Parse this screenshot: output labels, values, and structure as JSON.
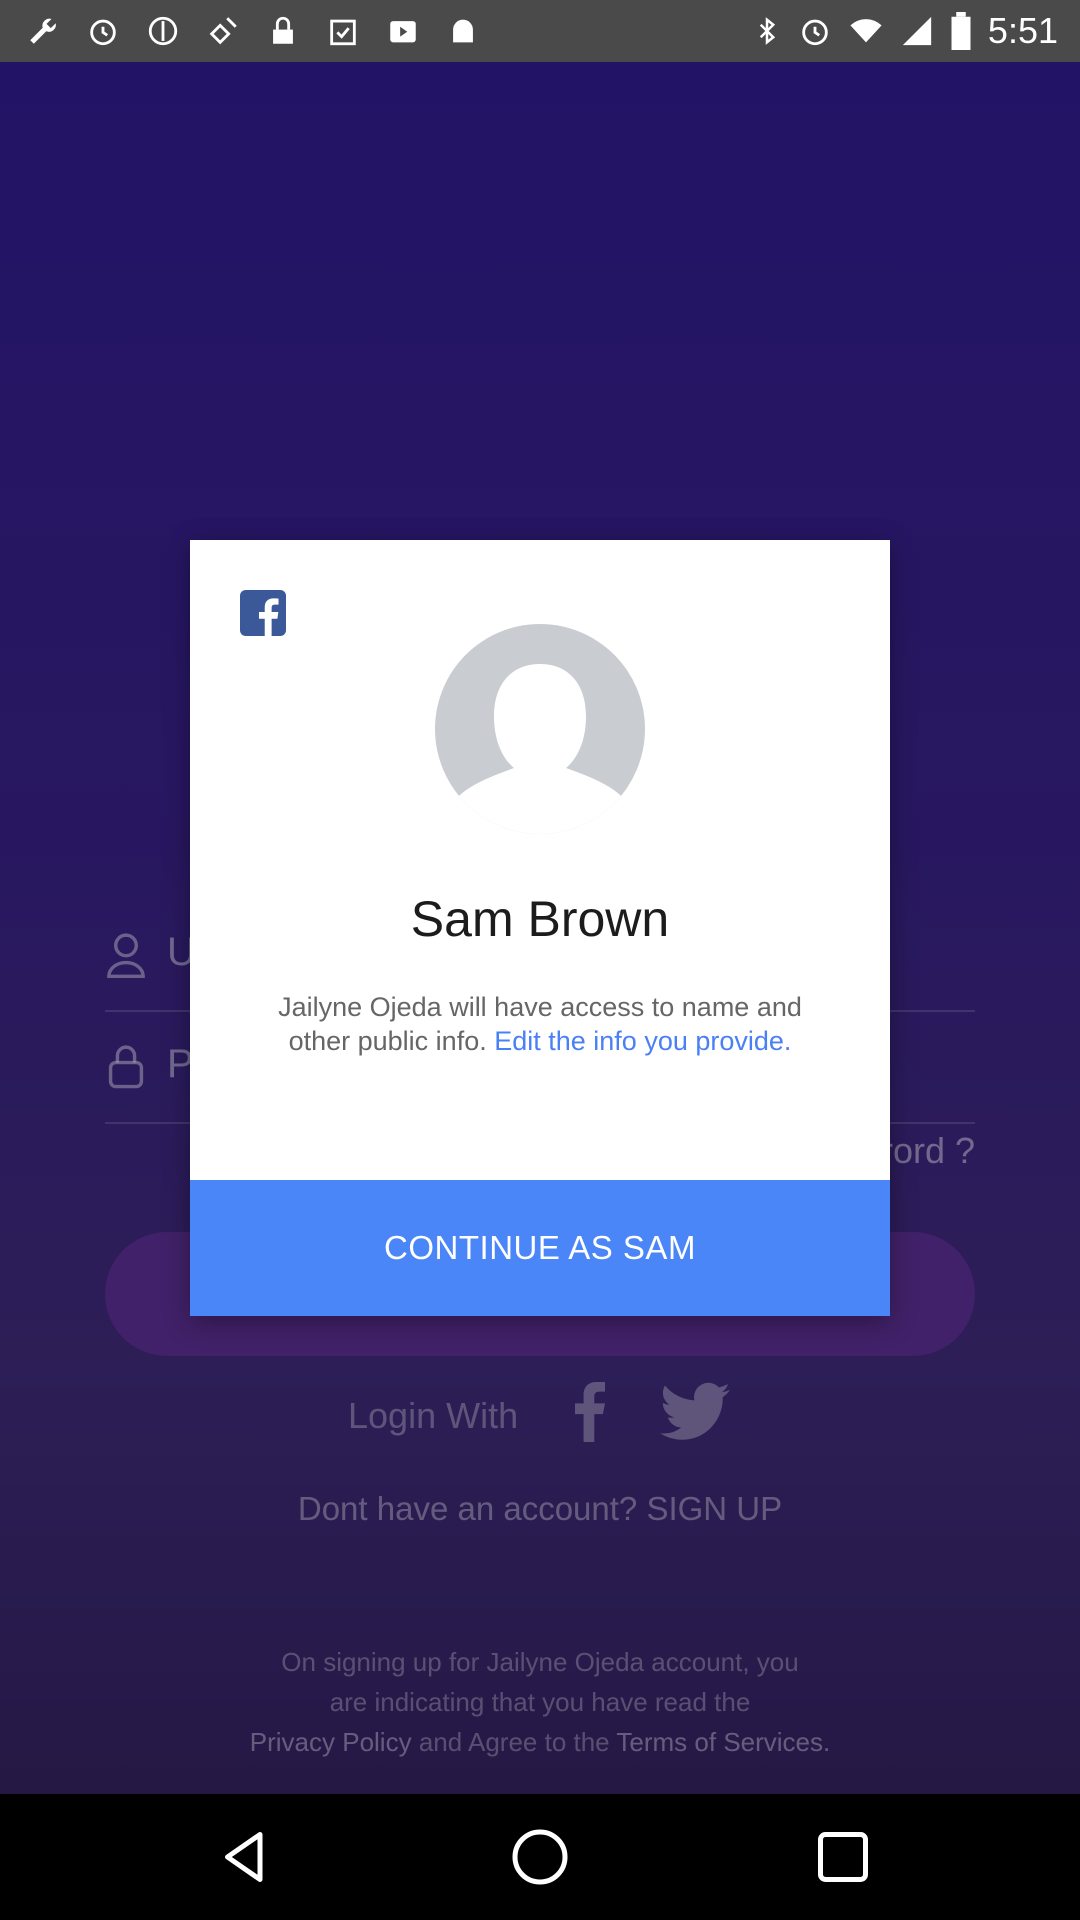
{
  "status_bar": {
    "time": "5:51",
    "left_icons": [
      "wrench-icon",
      "alarm-icon",
      "circle-icon",
      "satellite-icon",
      "lock-icon",
      "clipboard-check-icon",
      "play-icon",
      "android-icon"
    ],
    "right_icons": [
      "bluetooth-icon",
      "alarm-icon",
      "wifi-icon",
      "signal-icon",
      "battery-icon"
    ]
  },
  "background": {
    "username_placeholder": "U",
    "password_placeholder": "P",
    "forgot_password": "rord ?",
    "login_with": "Login With",
    "signup_text": "Dont have an account? SIGN UP",
    "terms_line1": "On signing up for Jailyne Ojeda account, you",
    "terms_line2": "are indicating that you have read the",
    "privacy_policy": "Privacy Policy",
    "and_agree": " and Agree to the ",
    "terms_of_services": "Terms of Services."
  },
  "dialog": {
    "user_name": "Sam Brown",
    "info_text": "Jailyne Ojeda will have access to name and other public info. ",
    "edit_link": "Edit the info you provide.",
    "continue_label": "CONTINUE AS SAM"
  },
  "colors": {
    "accent": "#4a86f7",
    "link": "#4a80f5",
    "facebook": "#3b5998"
  }
}
